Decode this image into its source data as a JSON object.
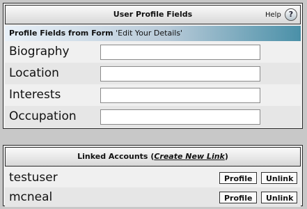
{
  "profile_panel": {
    "title": "User Profile Fields",
    "help_label": "Help",
    "help_icon_glyph": "?",
    "subheader_bold": "Profile Fields from Form",
    "subheader_form_name": "'Edit Your Details'",
    "fields": [
      {
        "label": "Biography",
        "value": ""
      },
      {
        "label": "Location",
        "value": ""
      },
      {
        "label": "Interests",
        "value": ""
      },
      {
        "label": "Occupation",
        "value": ""
      }
    ]
  },
  "linked_panel": {
    "title_prefix": "Linked Accounts (",
    "create_link": "Create New Link",
    "title_suffix": ")",
    "accounts": [
      {
        "name": "testuser",
        "profile_label": "Profile",
        "unlink_label": "Unlink"
      },
      {
        "name": "mcneal",
        "profile_label": "Profile",
        "unlink_label": "Unlink"
      }
    ]
  }
}
